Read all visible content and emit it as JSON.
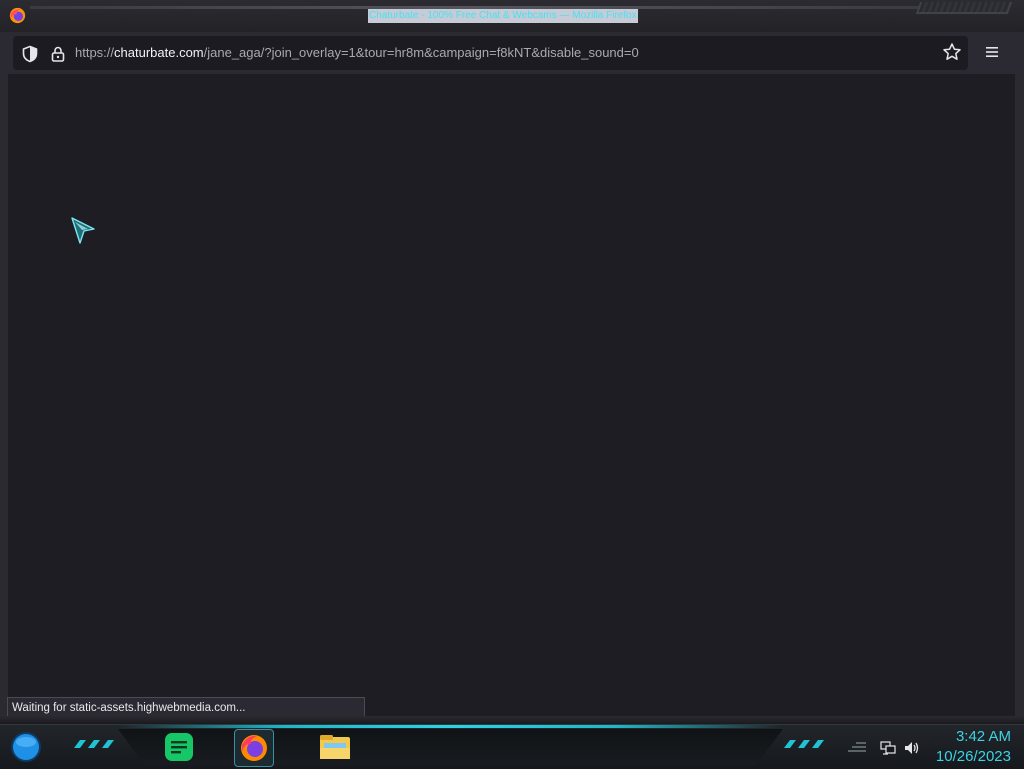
{
  "window": {
    "title": "Chaturbate - 100% Free Chat & Webcams — Mozilla Firefox"
  },
  "urlbar": {
    "prefix": "https://",
    "host": "chaturbate.com",
    "path": "/jane_aga/?join_overlay=1&tour=hr8m&campaign=f8kNT&disable_sound=0"
  },
  "status": {
    "text": "Waiting for static-assets.highwebmedia.com..."
  },
  "taskbar": {
    "apps": [
      "notes-icon",
      "firefox-icon",
      "file-explorer-icon"
    ],
    "accent_color": "#2ad4e6"
  },
  "clock": {
    "time": "3:42 AM",
    "date": "10/26/2023"
  }
}
